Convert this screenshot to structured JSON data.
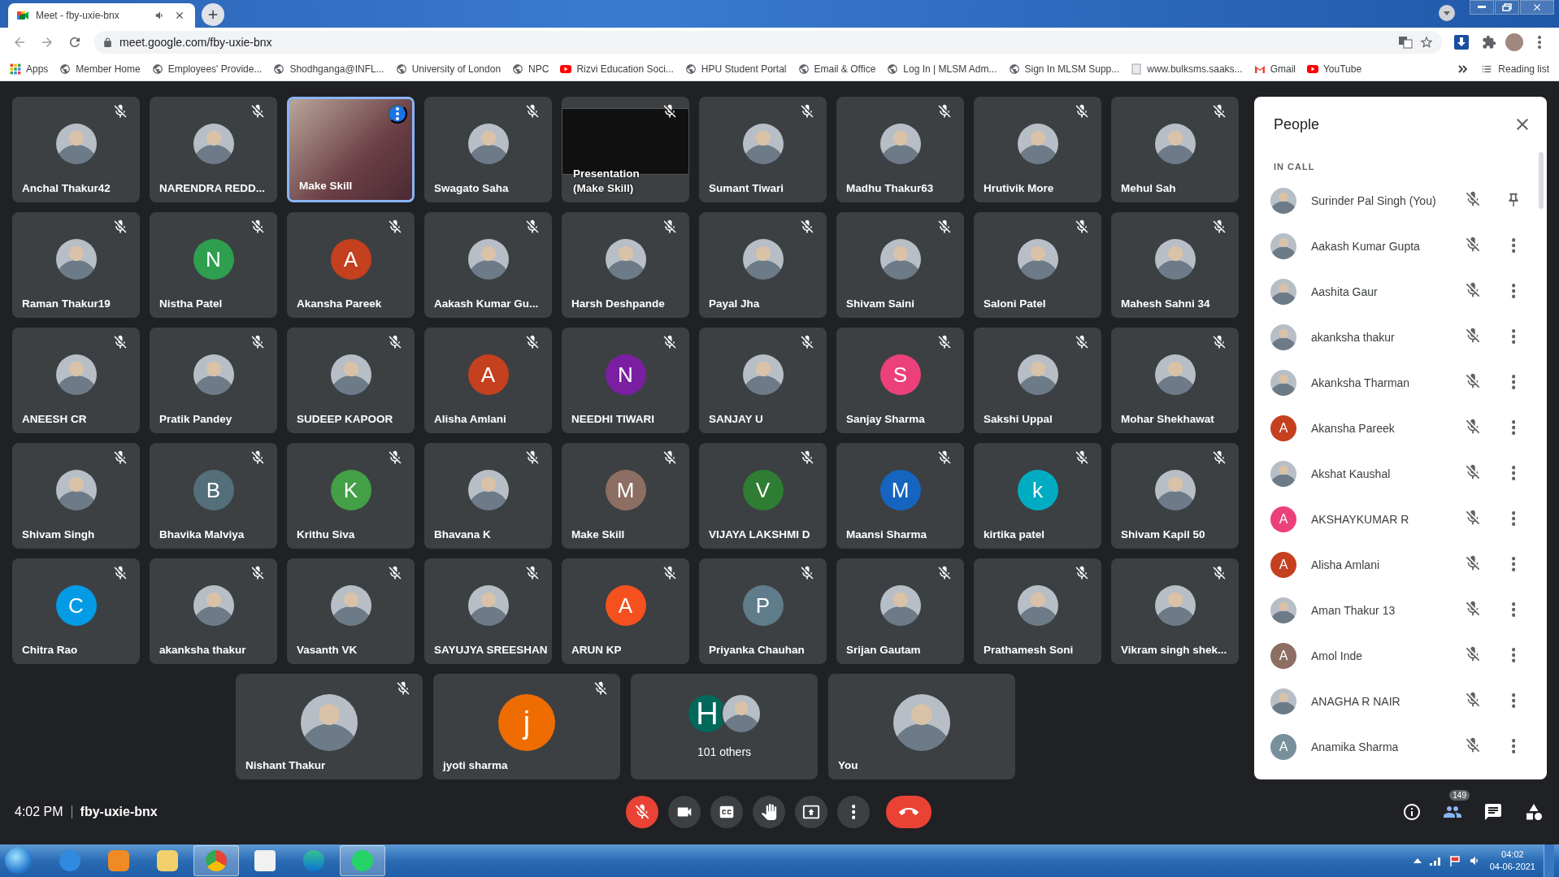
{
  "browser": {
    "tab": {
      "title": "Meet - fby-uxie-bnx"
    },
    "url": "meet.google.com/fby-uxie-bnx",
    "bookmarks": [
      {
        "label": "Apps",
        "kind": "apps"
      },
      {
        "label": "Member Home",
        "kind": "site"
      },
      {
        "label": "Employees' Provide...",
        "kind": "site"
      },
      {
        "label": "Shodhganga@INFL...",
        "kind": "site"
      },
      {
        "label": "University of London",
        "kind": "site"
      },
      {
        "label": "NPC",
        "kind": "site"
      },
      {
        "label": "Rizvi Education Soci...",
        "kind": "video"
      },
      {
        "label": "HPU Student Portal",
        "kind": "site"
      },
      {
        "label": "Email & Office",
        "kind": "site"
      },
      {
        "label": "Log In | MLSM Adm...",
        "kind": "site"
      },
      {
        "label": "Sign In MLSM Supp...",
        "kind": "site"
      },
      {
        "label": "www.bulksms.saaks...",
        "kind": "page"
      },
      {
        "label": "Gmail",
        "kind": "mail"
      },
      {
        "label": "YouTube",
        "kind": "video"
      }
    ],
    "reading_list": "Reading list"
  },
  "tiles": [
    {
      "name": "Anchal Thakur42",
      "kind": "photo",
      "muted": true,
      "speaking": false
    },
    {
      "name": "NARENDRA REDD...",
      "kind": "photo",
      "muted": true,
      "speaking": false
    },
    {
      "name": "Make Skill",
      "kind": "video",
      "muted": false,
      "speaking": true
    },
    {
      "name": "Swagato Saha",
      "kind": "photo",
      "muted": true,
      "speaking": false
    },
    {
      "name": "Presentation\n(Make Skill)",
      "kind": "presentation",
      "muted": true,
      "speaking": false
    },
    {
      "name": "Sumant Tiwari",
      "kind": "photo",
      "muted": true,
      "speaking": false
    },
    {
      "name": "Madhu Thakur63",
      "kind": "photo",
      "muted": true,
      "speaking": false
    },
    {
      "name": "Hrutivik More",
      "kind": "photo",
      "muted": true,
      "speaking": false
    },
    {
      "name": "Mehul Sah",
      "kind": "photo",
      "muted": true,
      "speaking": false
    },
    {
      "name": "Raman Thakur19",
      "kind": "photo",
      "muted": true,
      "speaking": false
    },
    {
      "name": "Nistha Patel",
      "kind": "letter",
      "letter": "N",
      "color": "#2e9e4f",
      "muted": true,
      "speaking": false
    },
    {
      "name": "Akansha Pareek",
      "kind": "letter",
      "letter": "A",
      "color": "#c5401f",
      "muted": true,
      "speaking": false
    },
    {
      "name": "Aakash Kumar Gu...",
      "kind": "photo",
      "muted": true,
      "speaking": false
    },
    {
      "name": "Harsh Deshpande",
      "kind": "photo",
      "muted": true,
      "speaking": false
    },
    {
      "name": "Payal Jha",
      "kind": "photo",
      "muted": true,
      "speaking": false
    },
    {
      "name": "Shivam Saini",
      "kind": "photo",
      "muted": true,
      "speaking": false
    },
    {
      "name": "Saloni Patel",
      "kind": "photo",
      "muted": true,
      "speaking": false
    },
    {
      "name": "Mahesh Sahni 34",
      "kind": "photo",
      "muted": true,
      "speaking": false
    },
    {
      "name": "ANEESH CR",
      "kind": "photo",
      "muted": true,
      "speaking": false
    },
    {
      "name": "Pratik Pandey",
      "kind": "photo",
      "muted": true,
      "speaking": false
    },
    {
      "name": "SUDEEP KAPOOR",
      "kind": "photo",
      "muted": true,
      "speaking": false
    },
    {
      "name": "Alisha Amlani",
      "kind": "letter",
      "letter": "A",
      "color": "#c5401f",
      "muted": true,
      "speaking": false
    },
    {
      "name": "NEEDHI TIWARI",
      "kind": "letter",
      "letter": "N",
      "color": "#7b1fa2",
      "muted": true,
      "speaking": false
    },
    {
      "name": "SANJAY U",
      "kind": "photo",
      "muted": true,
      "speaking": false
    },
    {
      "name": "Sanjay Sharma",
      "kind": "letter",
      "letter": "S",
      "color": "#ec407a",
      "muted": true,
      "speaking": false
    },
    {
      "name": "Sakshi Uppal",
      "kind": "photo",
      "muted": true,
      "speaking": false
    },
    {
      "name": "Mohar Shekhawat",
      "kind": "photo",
      "muted": true,
      "speaking": false
    },
    {
      "name": "Shivam Singh",
      "kind": "photo",
      "muted": true,
      "speaking": false
    },
    {
      "name": "Bhavika Malviya",
      "kind": "letter",
      "letter": "B",
      "color": "#546e7a",
      "muted": true,
      "speaking": false
    },
    {
      "name": "Krithu Siva",
      "kind": "letter",
      "letter": "K",
      "color": "#43a047",
      "muted": true,
      "speaking": false
    },
    {
      "name": "Bhavana K",
      "kind": "photo",
      "muted": true,
      "speaking": false
    },
    {
      "name": "Make Skill",
      "kind": "letter",
      "letter": "M",
      "color": "#8d6e63",
      "muted": true,
      "speaking": false
    },
    {
      "name": "VIJAYA LAKSHMI D",
      "kind": "letter",
      "letter": "V",
      "color": "#2e7d32",
      "muted": true,
      "speaking": false
    },
    {
      "name": "Maansi Sharma",
      "kind": "letter",
      "letter": "M",
      "color": "#1565c0",
      "muted": true,
      "speaking": false
    },
    {
      "name": "kirtika patel",
      "kind": "letter",
      "letter": "k",
      "color": "#00acc1",
      "muted": true,
      "speaking": false
    },
    {
      "name": "Shivam Kapil 50",
      "kind": "photo",
      "muted": true,
      "speaking": false
    },
    {
      "name": "Chitra Rao",
      "kind": "letter",
      "letter": "C",
      "color": "#039be5",
      "muted": true,
      "speaking": false
    },
    {
      "name": "akanksha thakur",
      "kind": "photo",
      "muted": true,
      "speaking": false
    },
    {
      "name": "Vasanth VK",
      "kind": "photo",
      "muted": true,
      "speaking": false
    },
    {
      "name": "SAYUJYA SREESHAN",
      "kind": "photo",
      "muted": true,
      "speaking": false
    },
    {
      "name": "ARUN KP",
      "kind": "letter",
      "letter": "A",
      "color": "#f4511e",
      "muted": true,
      "speaking": false
    },
    {
      "name": "Priyanka Chauhan",
      "kind": "letter",
      "letter": "P",
      "color": "#5f7c8a",
      "muted": true,
      "speaking": false
    },
    {
      "name": "Srijan Gautam",
      "kind": "photo",
      "muted": true,
      "speaking": false
    },
    {
      "name": "Prathamesh Soni",
      "kind": "photo",
      "muted": true,
      "speaking": false
    },
    {
      "name": "Vikram singh shek...",
      "kind": "photo",
      "muted": true,
      "speaking": false
    }
  ],
  "featured_tiles": [
    {
      "name": "Nishant Thakur",
      "kind": "photo",
      "muted": true
    },
    {
      "name": "jyoti sharma",
      "kind": "letter",
      "letter": "j",
      "color": "#ef6c00",
      "muted": true
    },
    {
      "name": "101 others",
      "kind": "others",
      "letter": "H",
      "color": "#00695c",
      "muted": false
    },
    {
      "name": "You",
      "kind": "photo",
      "muted": false
    }
  ],
  "people_panel": {
    "title": "People",
    "section": "IN CALL",
    "people": [
      {
        "name": "Surinder Pal Singh (You)",
        "kind": "photo",
        "pinned": true
      },
      {
        "name": "Aakash Kumar Gupta",
        "kind": "photo",
        "pinned": false
      },
      {
        "name": "Aashita Gaur",
        "kind": "photo",
        "pinned": false
      },
      {
        "name": "akanksha thakur",
        "kind": "photo",
        "pinned": false
      },
      {
        "name": "Akanksha Tharman",
        "kind": "photo",
        "pinned": false
      },
      {
        "name": "Akansha Pareek",
        "kind": "letter",
        "letter": "A",
        "color": "#c5401f",
        "pinned": false
      },
      {
        "name": "Akshat Kaushal",
        "kind": "photo",
        "pinned": false
      },
      {
        "name": "AKSHAYKUMAR R",
        "kind": "letter",
        "letter": "A",
        "color": "#ec407a",
        "pinned": false
      },
      {
        "name": "Alisha Amlani",
        "kind": "letter",
        "letter": "A",
        "color": "#c5401f",
        "pinned": false
      },
      {
        "name": "Aman Thakur 13",
        "kind": "photo",
        "pinned": false
      },
      {
        "name": "Amol Inde",
        "kind": "letter",
        "letter": "A",
        "color": "#8d6e63",
        "pinned": false
      },
      {
        "name": "ANAGHA R NAIR",
        "kind": "photo",
        "pinned": false
      },
      {
        "name": "Anamika Sharma",
        "kind": "letter",
        "letter": "A",
        "color": "#78909c",
        "pinned": false
      }
    ]
  },
  "controls": {
    "time": "4:02 PM",
    "meeting_code": "fby-uxie-bnx",
    "participant_count": "149"
  },
  "taskbar": {
    "time": "04:02",
    "date": "04-06-2021"
  }
}
